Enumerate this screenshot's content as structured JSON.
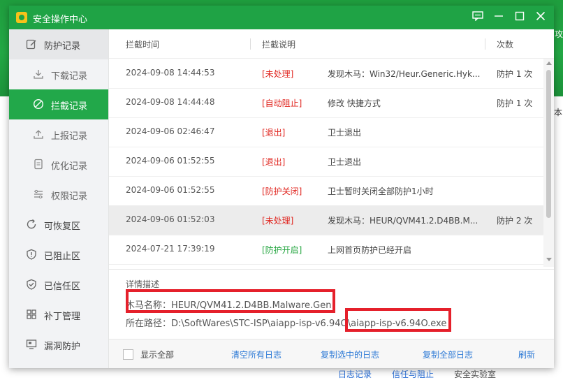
{
  "window": {
    "title": "安全操作中心"
  },
  "sidebar": {
    "items": [
      {
        "label": "防护记录",
        "icon": "edit-icon"
      },
      {
        "label": "下载记录",
        "icon": "download-icon"
      },
      {
        "label": "拦截记录",
        "icon": "block-icon"
      },
      {
        "label": "上报记录",
        "icon": "upload-icon"
      },
      {
        "label": "优化记录",
        "icon": "doc-icon"
      },
      {
        "label": "权限记录",
        "icon": "sliders-icon"
      },
      {
        "label": "可恢复区",
        "icon": "restore-icon"
      },
      {
        "label": "已阻止区",
        "icon": "shield-warning-icon"
      },
      {
        "label": "已信任区",
        "icon": "shield-check-icon"
      },
      {
        "label": "补丁管理",
        "icon": "grid-icon"
      },
      {
        "label": "漏洞防护",
        "icon": "monitor-icon"
      }
    ]
  },
  "table": {
    "headers": {
      "time": "拦截时间",
      "desc": "拦截说明",
      "count": "次数"
    },
    "rows": [
      {
        "time": "2024-09-08 14:44:53",
        "tag": "[未处理]",
        "tag_color": "#e0241e",
        "desc": "发现木马：Win32/Heur.Generic.Hyk...",
        "count": "防护 1 次"
      },
      {
        "time": "2024-09-08 14:44:48",
        "tag": "[自动阻止]",
        "tag_color": "#e0241e",
        "desc": "修改 快捷方式",
        "count": "防护 1 次"
      },
      {
        "time": "2024-09-06 02:46:47",
        "tag": "[退出]",
        "tag_color": "#e0241e",
        "desc": "卫士退出",
        "count": ""
      },
      {
        "time": "2024-09-06 01:52:55",
        "tag": "[退出]",
        "tag_color": "#e0241e",
        "desc": "卫士退出",
        "count": ""
      },
      {
        "time": "2024-09-06 01:52:55",
        "tag": "[防护关闭]",
        "tag_color": "#e0241e",
        "desc": "卫士暂时关闭全部防护1小时",
        "count": ""
      },
      {
        "time": "2024-09-06 01:52:03",
        "tag": "[未处理]",
        "tag_color": "#e0241e",
        "desc": "发现木马：HEUR/QVM41.2.D4BB.M...",
        "count": "防护 2 次"
      },
      {
        "time": "2024-07-21 17:39:19",
        "tag": "[防护开启]",
        "tag_color": "#23a53f",
        "desc": "上网首页防护已经开启",
        "count": ""
      }
    ]
  },
  "details": {
    "title": "详情描述",
    "name_line": "木马名称：HEUR/QVM41.2.D4BB.Malware.Gen",
    "path_line": "所在路径：D:\\SoftWares\\STC-ISP\\aiapp-isp-v6.94O\\aiapp-isp-v6.94O.exe"
  },
  "footer": {
    "show_all": "显示全部",
    "clear_all": "清空所有日志",
    "copy_selected": "复制选中的日志",
    "copy_all": "复制全部日志",
    "refresh": "刷新"
  },
  "background": {
    "side_text_1": "攻",
    "side_text_2": "本",
    "bottom_link_1": "日志记录",
    "bottom_link_2": "信任与阻止",
    "bottom_link_3": "安全实验室"
  },
  "colors": {
    "brand_green": "#1fa345",
    "active_green": "#22a84a",
    "link_blue": "#2d7ad6",
    "highlight_red": "#e5202b"
  }
}
